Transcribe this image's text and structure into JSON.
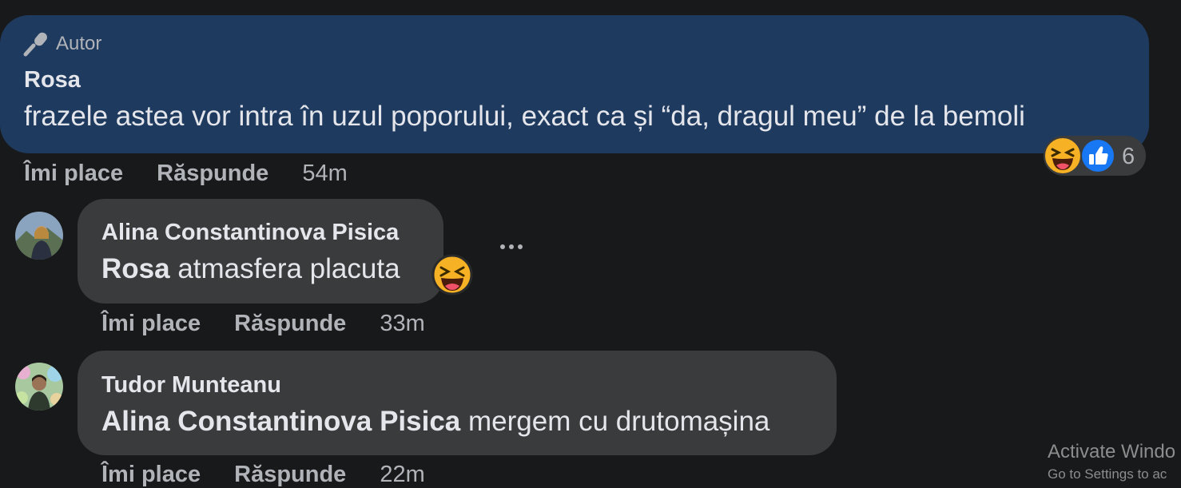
{
  "author_comment": {
    "badge_label": "Autor",
    "badge_icon": "microphone-icon",
    "name": "Rosa",
    "text": "frazele astea vor intra în uzul poporului, exact ca și “da, dragul meu” de la bemoli",
    "actions": {
      "like_label": "Îmi place",
      "reply_label": "Răspunde",
      "time": "54m"
    },
    "reactions": {
      "types": [
        "haha",
        "like"
      ],
      "count": "6"
    }
  },
  "replies": [
    {
      "name": "Alina Constantinova Pisica",
      "mention": "Rosa",
      "text": "atmasfera placuta",
      "emoji": "haha-emoji",
      "actions": {
        "like_label": "Îmi place",
        "reply_label": "Răspunde",
        "time": "33m"
      }
    },
    {
      "name": "Tudor Munteanu",
      "mention": "Alina Constantinova Pisica",
      "text": "mergem cu drutomașina",
      "actions": {
        "like_label": "Îmi place",
        "reply_label": "Răspunde",
        "time": "22m"
      }
    }
  ],
  "watermark": {
    "line1": "Activate Windo",
    "line2": "Go to Settings to ac"
  },
  "colors": {
    "background": "#18191a",
    "author_bubble": "#1f3a5f",
    "reply_bubble": "#3a3b3c",
    "like_blue": "#1877f2",
    "haha_yellow": "#f7b125"
  }
}
